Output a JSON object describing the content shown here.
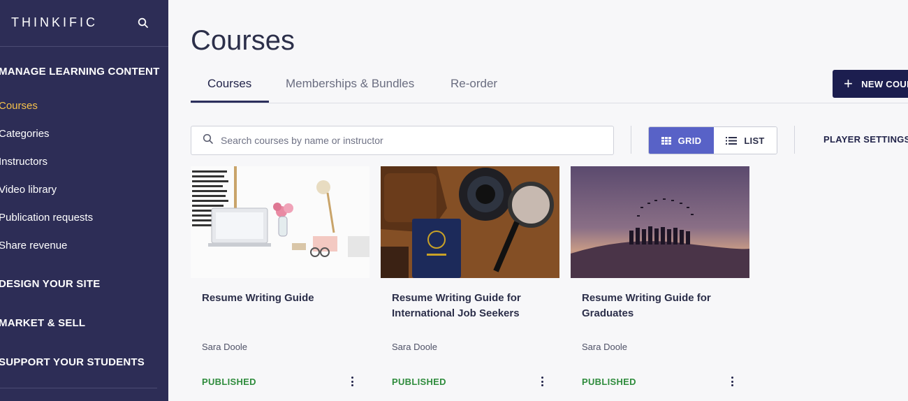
{
  "app": {
    "logo": "THINKIFIC"
  },
  "sidebar": {
    "sections": [
      {
        "label": "MANAGE LEARNING CONTENT"
      },
      {
        "label": "DESIGN YOUR SITE"
      },
      {
        "label": "MARKET & SELL"
      },
      {
        "label": "SUPPORT YOUR STUDENTS"
      }
    ],
    "items": [
      {
        "label": "Courses",
        "active": true
      },
      {
        "label": "Categories"
      },
      {
        "label": "Instructors"
      },
      {
        "label": "Video library"
      },
      {
        "label": "Publication requests"
      },
      {
        "label": "Share revenue"
      }
    ],
    "icons": {
      "search": "search-icon"
    }
  },
  "main": {
    "title": "Courses",
    "tabs": [
      {
        "label": "Courses",
        "active": true
      },
      {
        "label": "Memberships & Bundles"
      },
      {
        "label": "Re-order"
      }
    ],
    "new_button": "NEW COURSE",
    "search": {
      "placeholder": "Search courses by name or instructor"
    },
    "view": {
      "grid": "GRID",
      "list": "LIST",
      "selected": "grid"
    },
    "player_settings": "PLAYER SETTINGS"
  },
  "courses": [
    {
      "title": "Resume Writing Guide",
      "instructor": "Sara Doole",
      "status": "PUBLISHED"
    },
    {
      "title": "Resume Writing Guide for International Job Seekers",
      "instructor": "Sara Doole",
      "status": "PUBLISHED"
    },
    {
      "title": "Resume Writing Guide for Graduates",
      "instructor": "Sara Doole",
      "status": "PUBLISHED"
    }
  ],
  "colors": {
    "sidebar_bg": "#2d2d56",
    "active_nav": "#f5c14b",
    "primary_button": "#1c1e4f",
    "grid_toggle": "#5862c7",
    "status_published": "#2f8c3d"
  }
}
